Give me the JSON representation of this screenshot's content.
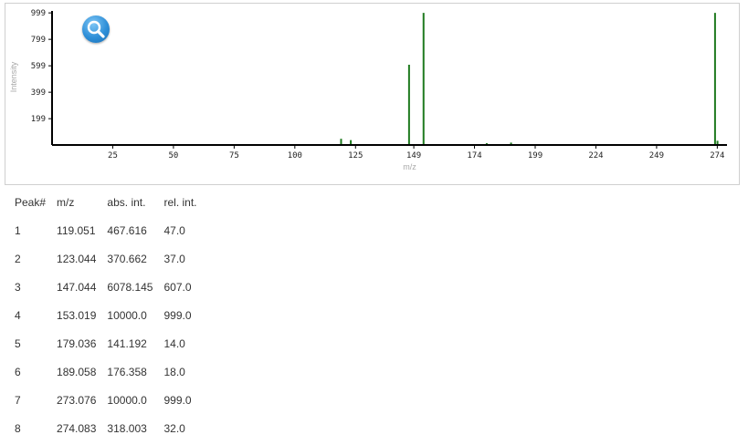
{
  "chart_data": {
    "type": "bar",
    "xlabel": "m/z",
    "ylabel": "Intensity",
    "xlim": [
      0,
      278
    ],
    "ylim": [
      0,
      1000
    ],
    "x_ticks": [
      25,
      50,
      75,
      100,
      125,
      149,
      174,
      199,
      224,
      249,
      274
    ],
    "y_ticks": [
      199,
      399,
      599,
      799,
      999
    ],
    "peaks": [
      {
        "mz": 119.051,
        "rel": 47
      },
      {
        "mz": 123.044,
        "rel": 37
      },
      {
        "mz": 147.044,
        "rel": 607
      },
      {
        "mz": 153.019,
        "rel": 999
      },
      {
        "mz": 179.036,
        "rel": 14
      },
      {
        "mz": 189.058,
        "rel": 18
      },
      {
        "mz": 273.076,
        "rel": 999
      },
      {
        "mz": 274.083,
        "rel": 32
      }
    ],
    "bar_color": "#1f7a1f"
  },
  "zoom": {
    "icon": "magnifier-icon"
  },
  "table": {
    "headers": [
      "Peak#",
      "m/z",
      "abs. int.",
      "rel. int."
    ],
    "rows": [
      [
        "1",
        "119.051",
        "467.616",
        "47.0"
      ],
      [
        "2",
        "123.044",
        "370.662",
        "37.0"
      ],
      [
        "3",
        "147.044",
        "6078.145",
        "607.0"
      ],
      [
        "4",
        "153.019",
        "10000.0",
        "999.0"
      ],
      [
        "5",
        "179.036",
        "141.192",
        "14.0"
      ],
      [
        "6",
        "189.058",
        "176.358",
        "18.0"
      ],
      [
        "7",
        "273.076",
        "10000.0",
        "999.0"
      ],
      [
        "8",
        "274.083",
        "318.003",
        "32.0"
      ]
    ]
  }
}
